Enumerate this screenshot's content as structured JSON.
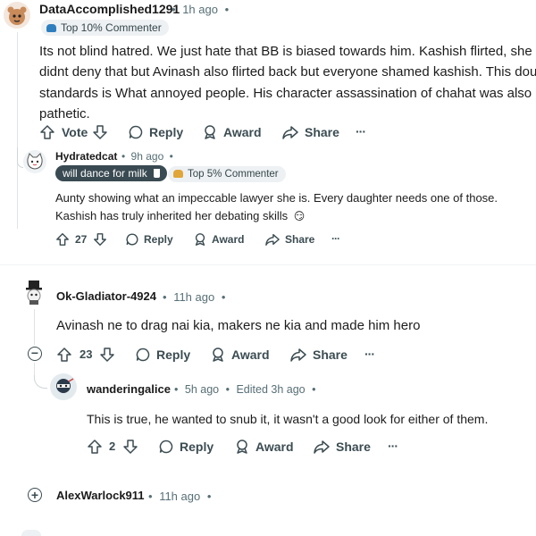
{
  "comments": [
    {
      "user": "DataAccomplished1291",
      "time": "1h ago",
      "flair": "Top 10% Commenter",
      "text_lines": [
        "Its not blind hatred. We just hate that BB is biased towards him. Kashish flirted, she",
        "didnt deny that but Avinash also flirted back but everyone shamed kashish. This double",
        "standards is What annoyed people. His character assassination of chahat was also",
        "pathetic."
      ],
      "vote_label": "Vote",
      "reply_label": "Reply",
      "award_label": "Award",
      "share_label": "Share",
      "more_label": "···"
    },
    {
      "user": "Hydratedcat",
      "time": "9h ago",
      "user_flair": "will dance for milk",
      "flair": "Top 5% Commenter",
      "text_lines": [
        "Aunty showing what an impeccable lawyer she is. Every daughter needs one of those.",
        "Kashish has truly inherited her debating skills"
      ],
      "emoji": "😏",
      "votes": "27",
      "reply_label": "Reply",
      "award_label": "Award",
      "share_label": "Share",
      "more_label": "···"
    },
    {
      "user": "Ok-Gladiator-4924",
      "time": "11h ago",
      "text": "Avinash ne to drag nai kia, makers ne kia and made him hero",
      "votes": "23",
      "collapse_symbol": "−",
      "reply_label": "Reply",
      "award_label": "Award",
      "share_label": "Share",
      "more_label": "···"
    },
    {
      "user": "wanderingalice",
      "time": "5h ago",
      "edited": "Edited 3h ago",
      "text": "This is true, he wanted to snub it, it wasn't a good look for either of them.",
      "votes": "2",
      "reply_label": "Reply",
      "award_label": "Award",
      "share_label": "Share",
      "more_label": "···"
    },
    {
      "user": "AlexWarlock911",
      "time": "11h ago",
      "expand_symbol": "+"
    }
  ],
  "separator": "•",
  "icons": [
    "upvote-icon",
    "downvote-icon",
    "reply-bubble-icon",
    "award-icon",
    "share-arrow-icon",
    "more-icon"
  ]
}
